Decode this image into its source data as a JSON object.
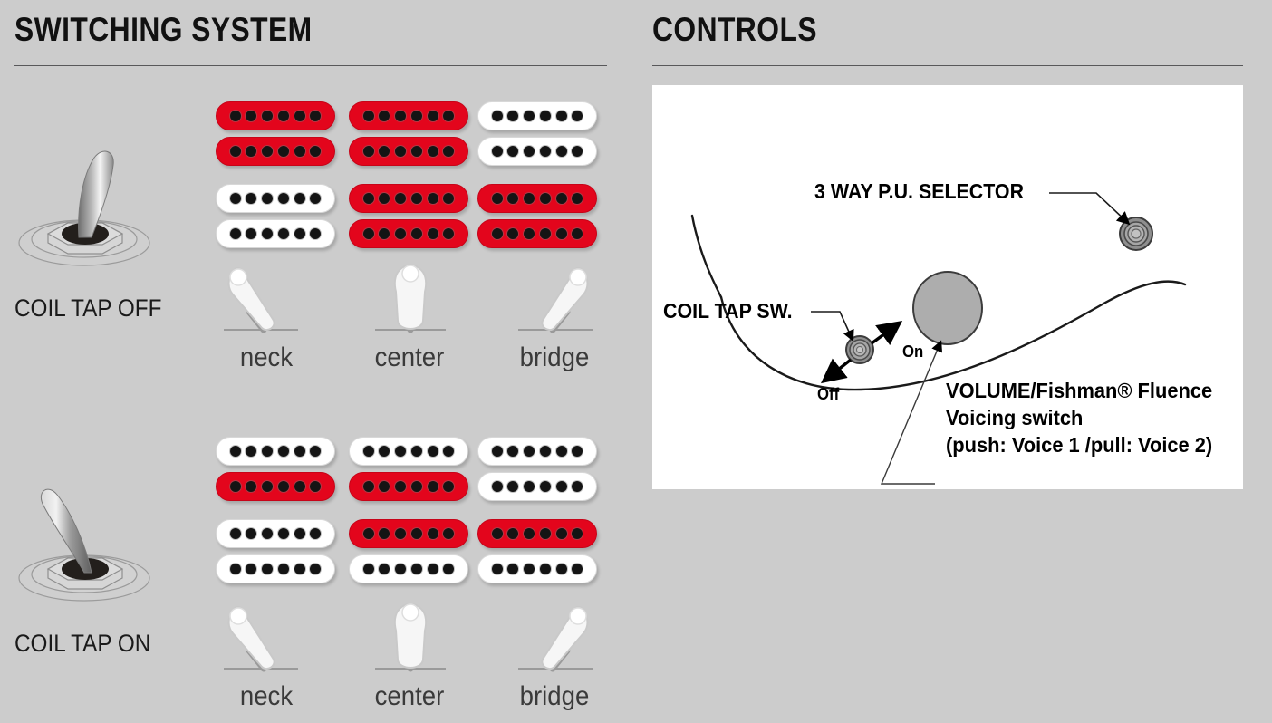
{
  "background_color": "#cccccc",
  "accent_red": "#e3051c",
  "sections": {
    "left": {
      "title": "SWITCHING SYSTEM"
    },
    "right": {
      "title": "CONTROLS"
    }
  },
  "switching_system": {
    "rows": [
      {
        "id": "coil-tap-off",
        "label": "COIL TAP OFF",
        "toggle_state": "off",
        "positions": [
          {
            "label": "neck",
            "lever": "left",
            "coils": [
              "on",
              "on"
            ]
          },
          {
            "label": "center",
            "lever": "up",
            "coils": [
              "on",
              "on"
            ]
          },
          {
            "label": "bridge",
            "lever": "right",
            "coils": [
              "off",
              "off"
            ]
          }
        ],
        "positions_row2": [
          {
            "label": "neck",
            "coils": [
              "off",
              "off"
            ]
          },
          {
            "label": "center",
            "coils": [
              "on",
              "on"
            ]
          },
          {
            "label": "bridge",
            "coils": [
              "on",
              "on"
            ]
          }
        ]
      },
      {
        "id": "coil-tap-on",
        "label": "COIL TAP ON",
        "toggle_state": "on",
        "positions": [
          {
            "label": "neck",
            "lever": "left",
            "coils": [
              "off",
              "on"
            ]
          },
          {
            "label": "center",
            "lever": "up",
            "coils": [
              "off",
              "on"
            ]
          },
          {
            "label": "bridge",
            "lever": "right",
            "coils": [
              "off",
              "off"
            ]
          }
        ],
        "positions_row2": [
          {
            "label": "neck",
            "coils": [
              "off",
              "off"
            ]
          },
          {
            "label": "center",
            "coils": [
              "on",
              "off"
            ]
          },
          {
            "label": "bridge",
            "coils": [
              "on",
              "off"
            ]
          }
        ]
      }
    ],
    "pole_count": 6
  },
  "controls": {
    "labels": {
      "selector": "3 WAY P.U. SELECTOR",
      "coil_tap_sw": "COIL TAP SW.",
      "on": "On",
      "off": "Off",
      "volume_line1": "VOLUME/Fishman® Fluence",
      "volume_line2": "Voicing switch",
      "volume_line3": "(push: Voice 1 /pull: Voice 2)"
    }
  }
}
